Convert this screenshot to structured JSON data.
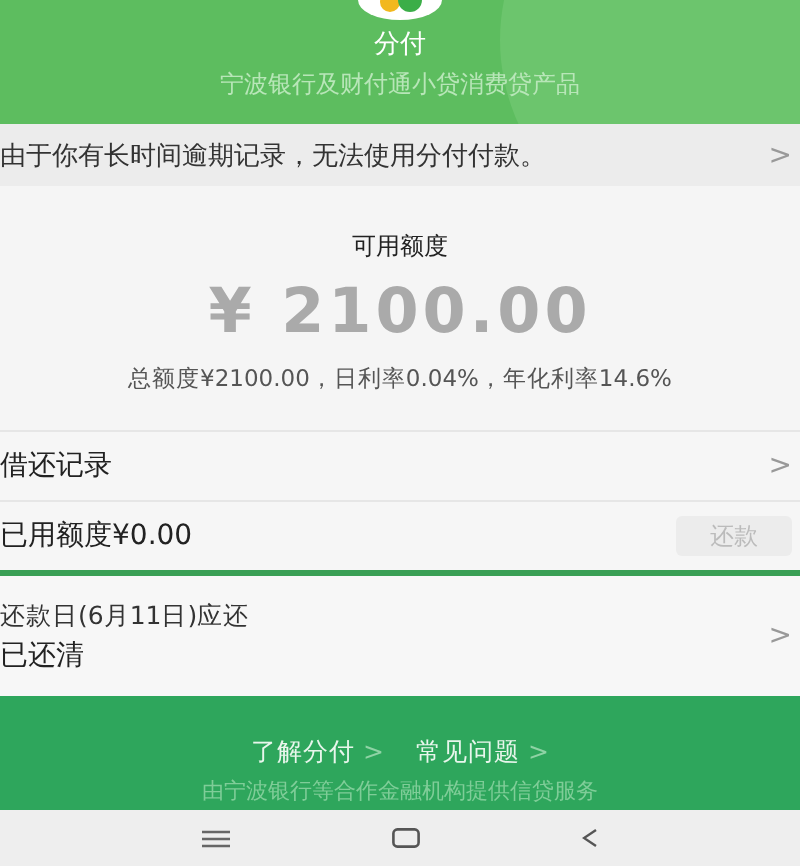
{
  "header": {
    "title": "分付",
    "subtitle": "宁波银行及财付通小贷消费贷产品"
  },
  "notice": {
    "text": "由于你有长时间逾期记录，无法使用分付付款。",
    "chevron": ">"
  },
  "credit": {
    "label": "可用额度",
    "amount": "¥ 2100.00",
    "details": "总额度¥2100.00，日利率0.04%，年化利率14.6%"
  },
  "records": {
    "label": "借还记录",
    "chevron": ">"
  },
  "used": {
    "label": "已用额度¥0.00",
    "button": {
      "label": "还款",
      "disabled": true
    }
  },
  "repayment": {
    "due": "还款日(6月11日)应还",
    "status": "已还清",
    "chevron": ">"
  },
  "footer": {
    "links": [
      {
        "label": "了解分付",
        "chevron": ">"
      },
      {
        "label": "常见问题",
        "chevron": ">"
      }
    ],
    "note": "由宁波银行等合作金融机构提供信贷服务"
  }
}
